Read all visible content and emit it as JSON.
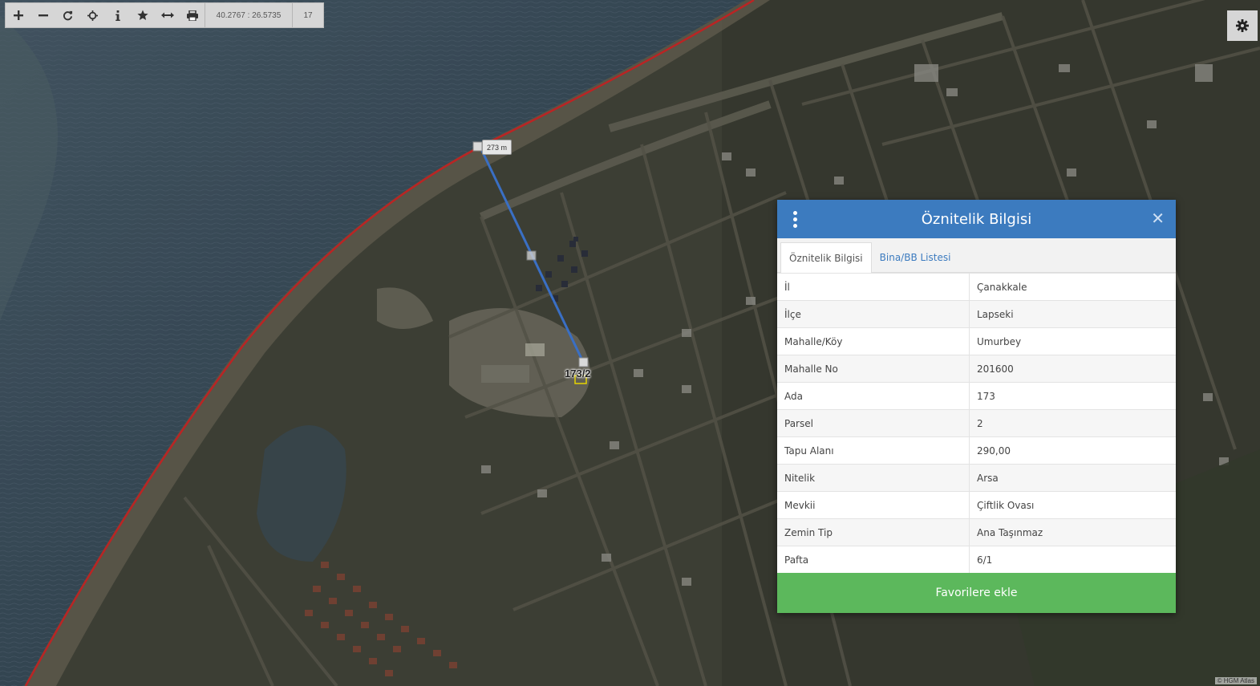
{
  "toolbar": {
    "buttons": [
      {
        "name": "zoom-in-button",
        "icon": "plus-icon"
      },
      {
        "name": "zoom-out-button",
        "icon": "minus-icon"
      },
      {
        "name": "refresh-button",
        "icon": "refresh-icon"
      },
      {
        "name": "locate-button",
        "icon": "crosshair-icon"
      },
      {
        "name": "info-button",
        "icon": "info-icon"
      },
      {
        "name": "favorites-button",
        "icon": "star-icon"
      },
      {
        "name": "measure-button",
        "icon": "measure-arrows-icon"
      },
      {
        "name": "print-button",
        "icon": "print-icon"
      }
    ],
    "coordinates": "40.2767 : 26.5735",
    "zoom_level": "17"
  },
  "settings": {
    "icon": "gear-icon"
  },
  "map": {
    "measure_label": "273 m",
    "parcel_label": "173/2",
    "attribution": "© HGM Atlas",
    "colors": {
      "boundary": "#d42a2a",
      "measure_line": "#3a6fc4",
      "water": "#3f5464",
      "land": "#4a4c3f"
    }
  },
  "panel": {
    "title": "Öznitelik Bilgisi",
    "tabs": [
      {
        "label": "Öznitelik Bilgisi",
        "active": true
      },
      {
        "label": "Bina/BB Listesi",
        "active": false
      }
    ],
    "rows": [
      {
        "key": "İl",
        "value": "Çanakkale"
      },
      {
        "key": "İlçe",
        "value": "Lapseki"
      },
      {
        "key": "Mahalle/Köy",
        "value": "Umurbey"
      },
      {
        "key": "Mahalle No",
        "value": "201600"
      },
      {
        "key": "Ada",
        "value": "173"
      },
      {
        "key": "Parsel",
        "value": "2"
      },
      {
        "key": "Tapu Alanı",
        "value": "290,00"
      },
      {
        "key": "Nitelik",
        "value": "Arsa"
      },
      {
        "key": "Mevkii",
        "value": "Çiftlik Ovası"
      },
      {
        "key": "Zemin Tip",
        "value": "Ana Taşınmaz"
      },
      {
        "key": "Pafta",
        "value": "6/1"
      }
    ],
    "favorite_button": "Favorilere ekle",
    "colors": {
      "header": "#3c7bbf",
      "button": "#5cb85c"
    }
  }
}
